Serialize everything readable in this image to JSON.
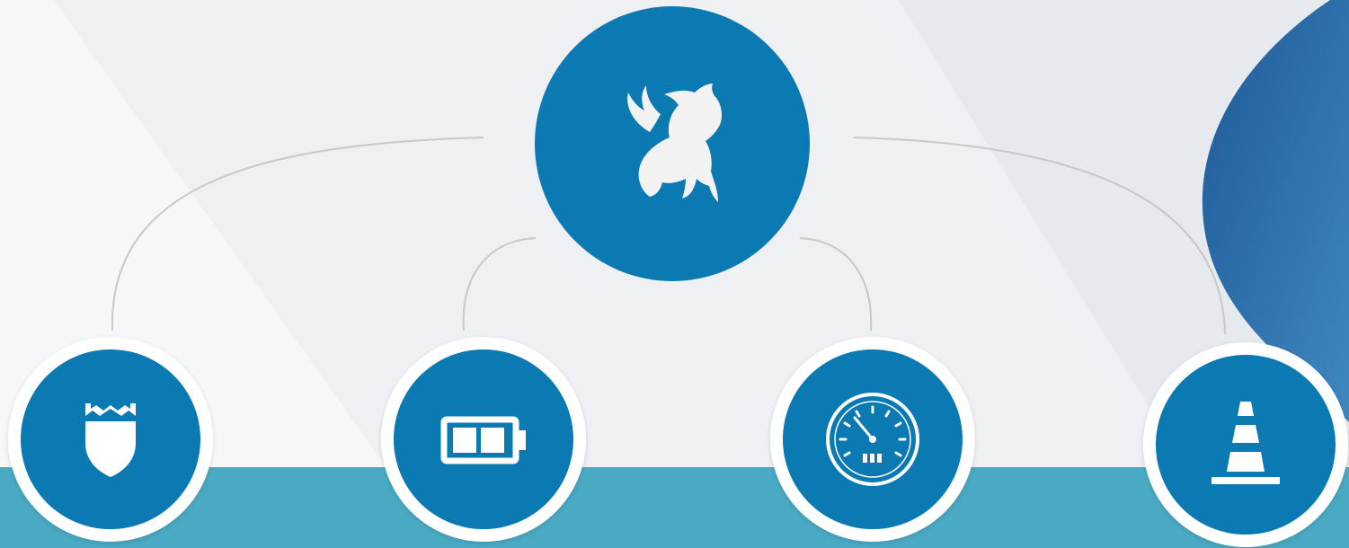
{
  "colors": {
    "background": "#eef0f3",
    "circle_fill": "#0b7ab2",
    "bottom_band": "#4aaac4",
    "connector_line": "#c8c8c8",
    "right_blob_dark": "#1e5a98",
    "right_blob_light": "#3f88c0",
    "icon_fill": "#ffffff"
  },
  "hub": {
    "icon": "horse-icon"
  },
  "children": [
    {
      "icon": "shield-icon"
    },
    {
      "icon": "battery-icon"
    },
    {
      "icon": "speedometer-icon"
    },
    {
      "icon": "traffic-cone-icon"
    }
  ]
}
